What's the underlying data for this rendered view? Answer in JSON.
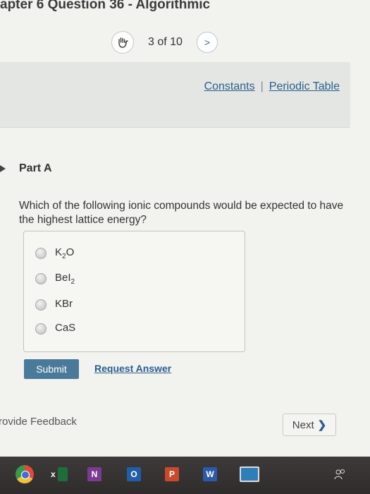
{
  "header": {
    "title": "apter 6 Question 36 - Algorithmic"
  },
  "nav": {
    "counter": "3 of 10",
    "next_symbol": ">"
  },
  "links": {
    "constants": "Constants",
    "separator": "|",
    "periodic_table": "Periodic Table"
  },
  "part": {
    "title": "Part A"
  },
  "question": {
    "text": "Which of the following ionic compounds would be expected to have the highest lattice energy?"
  },
  "options": [
    {
      "base": "K",
      "sub": "2",
      "tail": "O"
    },
    {
      "base": "BeI",
      "sub": "2",
      "tail": ""
    },
    {
      "base": "KBr",
      "sub": "",
      "tail": ""
    },
    {
      "base": "CaS",
      "sub": "",
      "tail": ""
    }
  ],
  "actions": {
    "submit": "Submit",
    "request_answer": "Request Answer"
  },
  "footer": {
    "feedback": "rovide Feedback",
    "next": "Next",
    "next_chevron": "❯"
  },
  "taskbar": {
    "items": [
      {
        "icon": "chrome-icon",
        "label": ""
      },
      {
        "icon": "excel-icon",
        "label": "x"
      },
      {
        "icon": "onenote-icon",
        "label": "N"
      },
      {
        "icon": "outlook-icon",
        "label": "O"
      },
      {
        "icon": "powerpoint-icon",
        "label": "P"
      },
      {
        "icon": "word-icon",
        "label": "W"
      },
      {
        "icon": "monitor-icon",
        "label": ""
      },
      {
        "icon": "people-icon",
        "label": ""
      }
    ]
  },
  "colors": {
    "accent": "#2b5d8f",
    "submit_bg": "#4a7a9a",
    "taskbar_bg": "#3b3737"
  }
}
